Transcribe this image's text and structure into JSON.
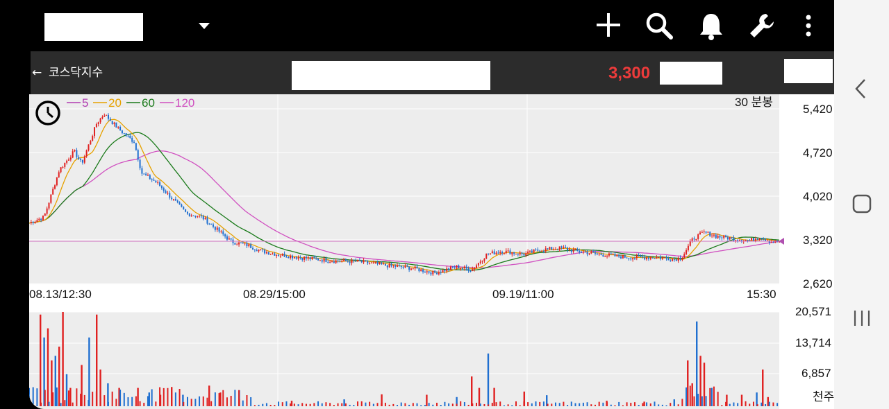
{
  "app_bar": {
    "icons": [
      "dropdown-arrow-icon",
      "plus-icon",
      "search-icon",
      "bell-icon",
      "wrench-icon",
      "more-vert-icon"
    ]
  },
  "sub_bar": {
    "back_arrow": "←",
    "index_name": "코스닥지수",
    "current_price": "3,300",
    "price_color": "#ee3b3b"
  },
  "chart": {
    "period_label": "30 분봉",
    "legend": [
      {
        "label": "5",
        "color": "#b13bb1"
      },
      {
        "label": "20",
        "color": "#e6a100"
      },
      {
        "label": "60",
        "color": "#1a7a1a"
      },
      {
        "label": "120",
        "color": "#d050c0"
      }
    ],
    "price_ticks": [
      "5,420",
      "4,720",
      "4,020",
      "3,320",
      "2,620"
    ],
    "time_labels": [
      "08.13/12:30",
      "08.29/15:00",
      "09.19/11:00",
      "15:30"
    ],
    "volume_ticks": [
      "20,571",
      "13,714",
      "6,857"
    ],
    "volume_unit": "천주"
  },
  "chart_data": {
    "type": "candlestick",
    "price_ylim": [
      2620,
      5420
    ],
    "volume_ylim": [
      0,
      20571
    ],
    "x_labels": [
      "08.13/12:30",
      "08.29/15:00",
      "09.19/11:00",
      "15:30"
    ],
    "ma_periods": [
      5,
      20,
      60,
      120
    ],
    "last_price": 3300,
    "price_path": [
      {
        "x": 0.0,
        "close": 3600
      },
      {
        "x": 0.02,
        "close": 3700
      },
      {
        "x": 0.04,
        "close": 4450
      },
      {
        "x": 0.06,
        "close": 4750
      },
      {
        "x": 0.07,
        "close": 4550
      },
      {
        "x": 0.09,
        "close": 5200
      },
      {
        "x": 0.1,
        "close": 5350
      },
      {
        "x": 0.12,
        "close": 5100
      },
      {
        "x": 0.14,
        "close": 4900
      },
      {
        "x": 0.15,
        "close": 4400
      },
      {
        "x": 0.17,
        "close": 4250
      },
      {
        "x": 0.19,
        "close": 4000
      },
      {
        "x": 0.21,
        "close": 3750
      },
      {
        "x": 0.23,
        "close": 3700
      },
      {
        "x": 0.25,
        "close": 3500
      },
      {
        "x": 0.27,
        "close": 3300
      },
      {
        "x": 0.29,
        "close": 3250
      },
      {
        "x": 0.31,
        "close": 3150
      },
      {
        "x": 0.33,
        "close": 3100
      },
      {
        "x": 0.36,
        "close": 3050
      },
      {
        "x": 0.4,
        "close": 3000
      },
      {
        "x": 0.44,
        "close": 2980
      },
      {
        "x": 0.47,
        "close": 2930
      },
      {
        "x": 0.51,
        "close": 2880
      },
      {
        "x": 0.54,
        "close": 2800
      },
      {
        "x": 0.57,
        "close": 2900
      },
      {
        "x": 0.59,
        "close": 2850
      },
      {
        "x": 0.61,
        "close": 3100
      },
      {
        "x": 0.63,
        "close": 3150
      },
      {
        "x": 0.66,
        "close": 3100
      },
      {
        "x": 0.68,
        "close": 3170
      },
      {
        "x": 0.71,
        "close": 3200
      },
      {
        "x": 0.73,
        "close": 3150
      },
      {
        "x": 0.76,
        "close": 3100
      },
      {
        "x": 0.8,
        "close": 3050
      },
      {
        "x": 0.84,
        "close": 3050
      },
      {
        "x": 0.86,
        "close": 3020
      },
      {
        "x": 0.87,
        "close": 3050
      },
      {
        "x": 0.885,
        "close": 3350
      },
      {
        "x": 0.9,
        "close": 3450
      },
      {
        "x": 0.92,
        "close": 3380
      },
      {
        "x": 0.94,
        "close": 3350
      },
      {
        "x": 0.96,
        "close": 3320
      },
      {
        "x": 0.975,
        "close": 3380
      },
      {
        "x": 0.99,
        "close": 3300
      }
    ],
    "volume_bars": [
      {
        "x": 0.015,
        "v": 20000
      },
      {
        "x": 0.02,
        "v": 15000
      },
      {
        "x": 0.025,
        "v": 17000
      },
      {
        "x": 0.03,
        "v": 10000
      },
      {
        "x": 0.035,
        "v": 11000
      },
      {
        "x": 0.04,
        "v": 13000
      },
      {
        "x": 0.045,
        "v": 20571
      },
      {
        "x": 0.05,
        "v": 7000
      },
      {
        "x": 0.055,
        "v": 4000
      },
      {
        "x": 0.07,
        "v": 9000
      },
      {
        "x": 0.08,
        "v": 15000
      },
      {
        "x": 0.09,
        "v": 20000
      },
      {
        "x": 0.095,
        "v": 8000
      },
      {
        "x": 0.105,
        "v": 5000
      },
      {
        "x": 0.12,
        "v": 4000
      },
      {
        "x": 0.145,
        "v": 4000
      },
      {
        "x": 0.16,
        "v": 3000
      },
      {
        "x": 0.175,
        "v": 2500
      },
      {
        "x": 0.19,
        "v": 4200
      },
      {
        "x": 0.205,
        "v": 2500
      },
      {
        "x": 0.24,
        "v": 4500
      },
      {
        "x": 0.255,
        "v": 3000
      },
      {
        "x": 0.28,
        "v": 3500
      },
      {
        "x": 0.28,
        "v": 1500
      },
      {
        "x": 0.35,
        "v": 1200
      },
      {
        "x": 0.42,
        "v": 1500
      },
      {
        "x": 0.47,
        "v": 2600
      },
      {
        "x": 0.53,
        "v": 2500
      },
      {
        "x": 0.57,
        "v": 2000
      },
      {
        "x": 0.59,
        "v": 6500
      },
      {
        "x": 0.6,
        "v": 4000
      },
      {
        "x": 0.612,
        "v": 11500
      },
      {
        "x": 0.62,
        "v": 4000
      },
      {
        "x": 0.66,
        "v": 3200
      },
      {
        "x": 0.69,
        "v": 2400
      },
      {
        "x": 0.77,
        "v": 1200
      },
      {
        "x": 0.82,
        "v": 1000
      },
      {
        "x": 0.86,
        "v": 1500
      },
      {
        "x": 0.878,
        "v": 10000
      },
      {
        "x": 0.884,
        "v": 5000
      },
      {
        "x": 0.89,
        "v": 18500
      },
      {
        "x": 0.895,
        "v": 11000
      },
      {
        "x": 0.9,
        "v": 9500
      },
      {
        "x": 0.91,
        "v": 4000
      },
      {
        "x": 0.93,
        "v": 2500
      },
      {
        "x": 0.95,
        "v": 2500
      },
      {
        "x": 0.97,
        "v": 3000
      },
      {
        "x": 0.978,
        "v": 8000
      },
      {
        "x": 0.985,
        "v": 2000
      }
    ]
  },
  "nav_bar": {
    "icons": [
      "back-chevron-icon",
      "home-square-icon",
      "recents-lines-icon"
    ]
  }
}
